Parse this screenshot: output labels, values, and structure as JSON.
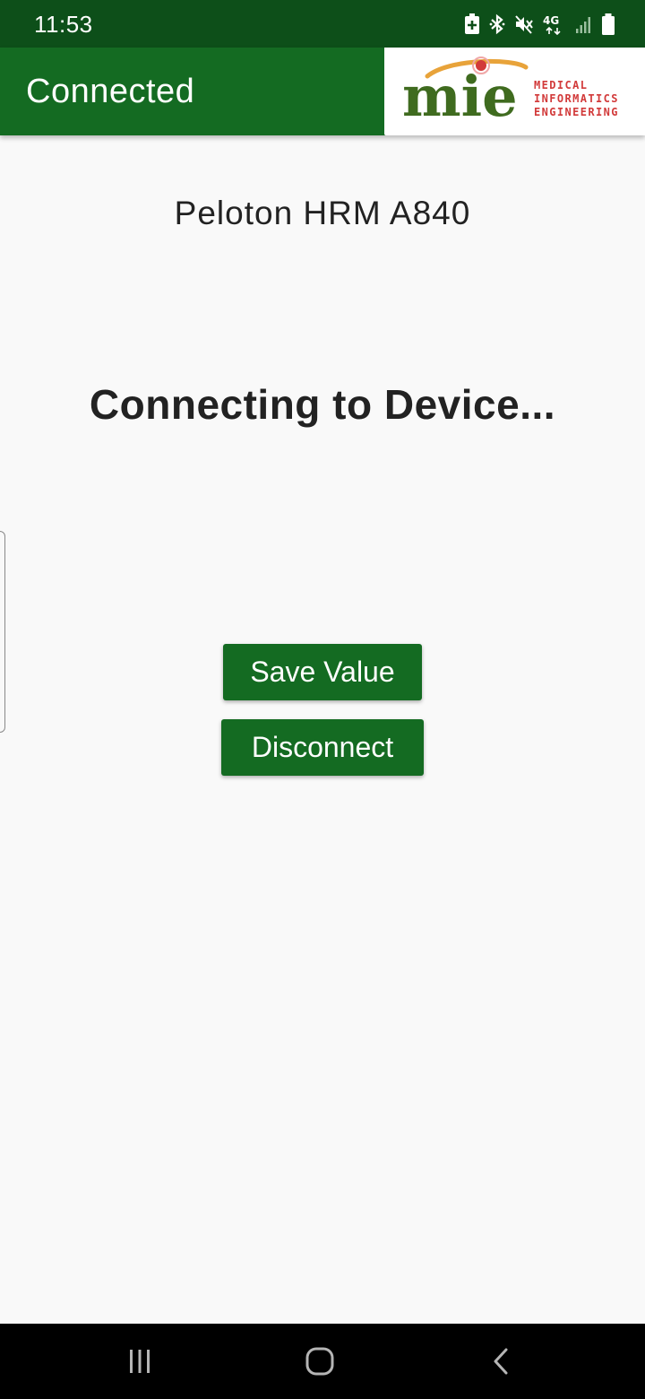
{
  "status_bar": {
    "time": "11:53",
    "network_label": "4G",
    "icons": [
      "battery-saver-icon",
      "bluetooth-icon",
      "mute-icon",
      "network-4g-icon",
      "signal-icon",
      "battery-icon"
    ]
  },
  "app_bar": {
    "title": "Connected",
    "logo": {
      "text": "mie",
      "lines": [
        "MEDICAL",
        "INFORMATICS",
        "ENGINEERING"
      ]
    }
  },
  "main": {
    "device_name": "Peloton HRM A840",
    "status_message": "Connecting to Device...",
    "save_button_label": "Save Value",
    "disconnect_button_label": "Disconnect"
  },
  "nav_bar": {
    "icons": [
      "recent-apps-icon",
      "home-icon",
      "back-icon"
    ]
  },
  "colors": {
    "status_bar": "#0d4f19",
    "app_bar": "#146b22",
    "button": "#146b22",
    "background": "#f9f9f9",
    "text": "#222222",
    "logo_green": "#3f6b1f",
    "logo_orange": "#e8a33a",
    "logo_red": "#d23a3a"
  }
}
